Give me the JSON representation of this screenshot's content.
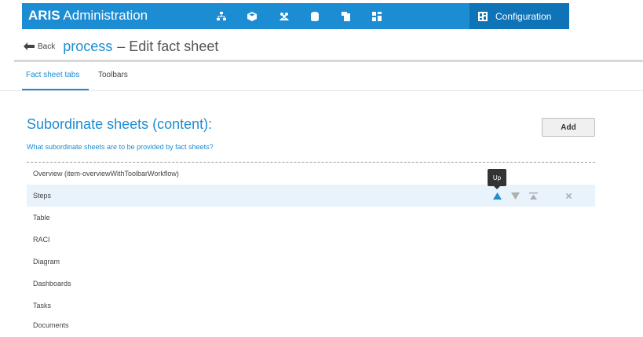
{
  "app": {
    "brand_bold": "ARIS",
    "brand_rest": "Administration"
  },
  "nav": {
    "icons": [
      "structure-icon",
      "cube-icon",
      "users-icon",
      "database-icon",
      "document-export-icon",
      "dashboard-grid-icon"
    ],
    "config_label": "Configuration"
  },
  "header": {
    "back_label": "Back",
    "object_name": "process",
    "title_rest": "– Edit fact sheet"
  },
  "tabs": [
    {
      "label": "Fact sheet tabs",
      "active": true
    },
    {
      "label": "Toolbars",
      "active": false
    }
  ],
  "section": {
    "title": "Subordinate sheets (content):",
    "subtitle": "What subordinate sheets are to be provided by fact sheets?",
    "add_label": "Add"
  },
  "rows": [
    {
      "label": "Overview (item-overviewWithToolbarWorkflow)"
    },
    {
      "label": "Steps",
      "highlighted": true
    },
    {
      "label": "Table"
    },
    {
      "label": "RACI"
    },
    {
      "label": "Diagram"
    },
    {
      "label": "Dashboards"
    },
    {
      "label": "Tasks"
    },
    {
      "label": "Documents"
    }
  ],
  "tooltip": {
    "text": "Up"
  },
  "colors": {
    "accent": "#1d8dd3",
    "accent_dark": "#0f73b8",
    "highlight": "#e8f3fb",
    "muted_icon": "#b0b0b0"
  }
}
